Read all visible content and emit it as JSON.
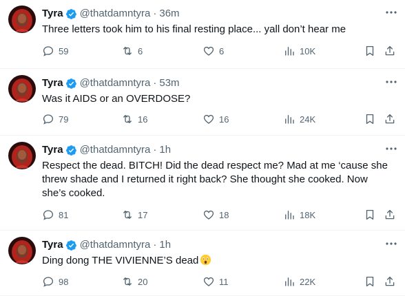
{
  "colors": {
    "verified": "#1d9bf0",
    "muted": "#536471",
    "text": "#0f1419",
    "divider": "#eff3f4"
  },
  "icons": {
    "reply": "reply-icon",
    "retweet": "retweet-icon",
    "like": "heart-icon",
    "views": "views-icon",
    "bookmark": "bookmark-icon",
    "share": "share-icon",
    "more": "more-icon",
    "verified": "verified-badge-icon"
  },
  "tweets": [
    {
      "name": "Tyra",
      "handle": "@thatdamntyra",
      "separator": "·",
      "time": "36m",
      "text": "Three letters took him to his final resting place... yall don’t hear me",
      "replies": "59",
      "retweets": "6",
      "likes": "6",
      "views": "10K"
    },
    {
      "name": "Tyra",
      "handle": "@thatdamntyra",
      "separator": "·",
      "time": "53m",
      "text": "Was it AIDS or an OVERDOSE?",
      "replies": "79",
      "retweets": "16",
      "likes": "16",
      "views": "24K"
    },
    {
      "name": "Tyra",
      "handle": "@thatdamntyra",
      "separator": "·",
      "time": "1h",
      "text": "Respect the dead. BITCH! Did the dead respect me? Mad at me ‘cause she threw shade and I returned it right back? She thought she cooked. Now she’s cooked.",
      "replies": "81",
      "retweets": "17",
      "likes": "18",
      "views": "18K"
    },
    {
      "name": "Tyra",
      "handle": "@thatdamntyra",
      "separator": "·",
      "time": "1h",
      "text": "Ding dong THE VIVIENNE’S dead",
      "replies": "98",
      "retweets": "20",
      "likes": "11",
      "views": "22K"
    }
  ]
}
